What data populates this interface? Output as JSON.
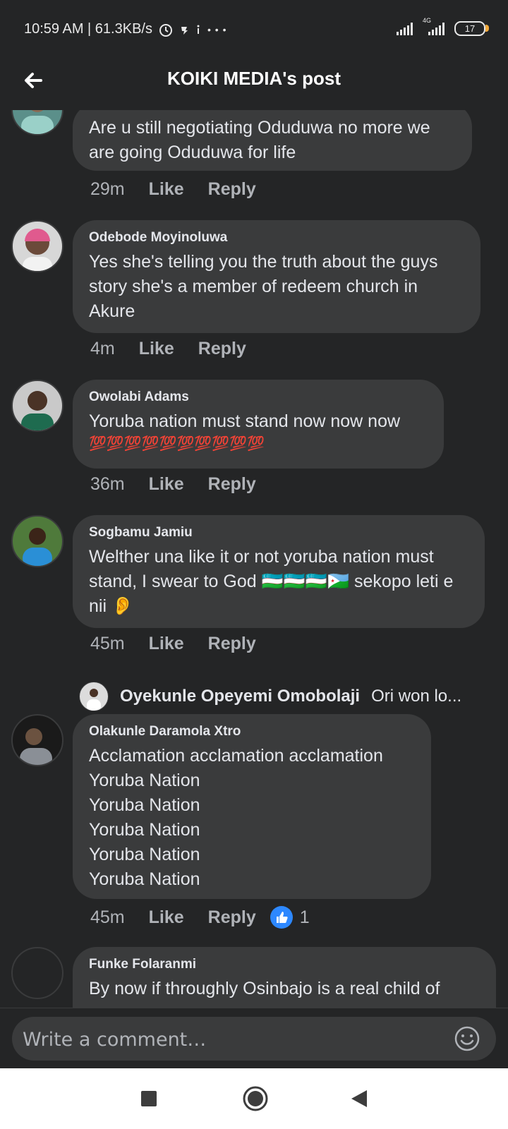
{
  "status_bar": {
    "time_speed": "10:59 AM | 61.3KB/s",
    "more": "• • •",
    "network_4g": "4G",
    "battery": "17"
  },
  "header": {
    "title": "KOIKI MEDIA's post"
  },
  "comments": [
    {
      "author": "",
      "text": "Are u still negotiating Oduduwa no more we are going Oduduwa for life",
      "time": "29m",
      "like_label": "Like",
      "reply_label": "Reply"
    },
    {
      "author": "Odebode Moyinoluwa",
      "text": "Yes she's telling you the truth about the guys story she's a member of redeem  church in Akure",
      "time": "4m",
      "like_label": "Like",
      "reply_label": "Reply"
    },
    {
      "author": "Owolabi Adams",
      "text": "Yoruba nation must stand now now now",
      "emoji_line": "💯💯💯💯💯💯💯💯💯💯",
      "time": "36m",
      "like_label": "Like",
      "reply_label": "Reply"
    },
    {
      "author": "Sogbamu Jamiu",
      "text": "Welther una like it or not yoruba nation must stand, I swear to God 🇺🇿🇺🇿🇺🇿🇩🇯 sekopo leti e nii 👂",
      "time": "45m",
      "like_label": "Like",
      "reply_label": "Reply"
    },
    {
      "author": "Olakunle Daramola Xtro",
      "text": "Acclamation acclamation acclamation\nYoruba Nation\nYoruba Nation\nYoruba Nation\nYoruba Nation\nYoruba Nation",
      "time": "45m",
      "like_label": "Like",
      "reply_label": "Reply",
      "like_count": "1"
    },
    {
      "author": "Funke Folaranmi",
      "text": "By now if throughly Osinbajo is a real child of"
    }
  ],
  "reply_preview": {
    "name": "Oyekunle Opeyemi Omobolaji",
    "snippet": "Ori won lo..."
  },
  "composer": {
    "placeholder": "Write a comment…"
  },
  "colors": {
    "background": "#242526",
    "bubble": "#3a3b3c",
    "text": "#e4e6eb",
    "muted": "#b0b3b8",
    "like_blue": "#2d88ff"
  }
}
